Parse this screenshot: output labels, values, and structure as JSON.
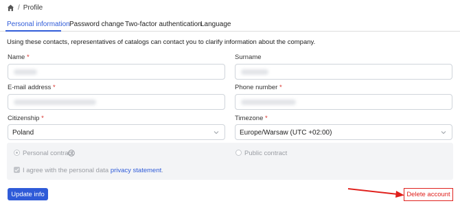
{
  "breadcrumb": {
    "home_icon": "home-icon",
    "separator": "/",
    "current": "Profile"
  },
  "tabs": [
    {
      "label": "Personal information",
      "active": true
    },
    {
      "label": "Password change",
      "active": false
    },
    {
      "label": "Two-factor authentication",
      "active": false
    },
    {
      "label": "Language",
      "active": false
    }
  ],
  "intro_text": "Using these contacts, representatives of catalogs can contact you to clarify information about the company.",
  "form": {
    "name": {
      "label": "Name",
      "required_mark": "*"
    },
    "surname": {
      "label": "Surname"
    },
    "email": {
      "label": "E-mail address",
      "required_mark": "*"
    },
    "phone": {
      "label": "Phone number",
      "required_mark": "*"
    },
    "citizenship": {
      "label": "Citizenship",
      "required_mark": "*",
      "value": "Poland"
    },
    "timezone": {
      "label": "Timezone",
      "required_mark": "*",
      "value": "Europe/Warsaw (UTC +02:00)"
    }
  },
  "contract": {
    "personal_label": "Personal contract",
    "public_label": "Public contract",
    "agree_text": "I agree with the personal data",
    "agree_link": "privacy statement",
    "agree_end": "."
  },
  "buttons": {
    "update_label": "Update info",
    "delete_label": "Delete account"
  },
  "colors": {
    "accent": "#2f5bd8",
    "required": "#d9302a",
    "delete": "#e0201c",
    "annotation": "#e0201c"
  }
}
